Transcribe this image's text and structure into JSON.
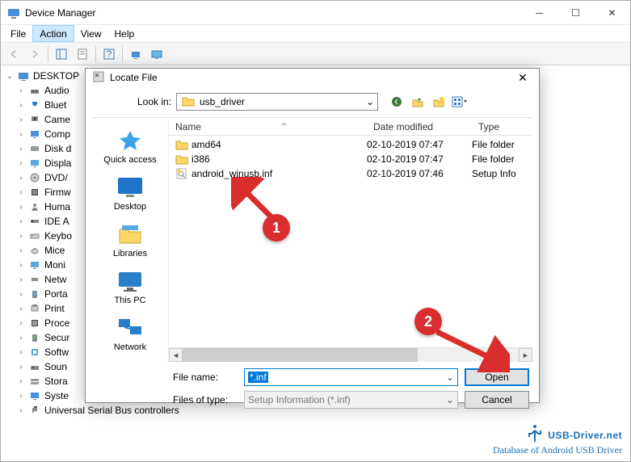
{
  "window": {
    "title": "Device Manager",
    "menu": [
      "File",
      "Action",
      "View",
      "Help"
    ],
    "active_menu_index": 1
  },
  "tree": {
    "root": "DESKTOP",
    "nodes": [
      "Audio",
      "Bluet",
      "Came",
      "Comp",
      "Disk d",
      "Displa",
      "DVD/",
      "Firmw",
      "Huma",
      "IDE A",
      "Keybo",
      "Mice",
      "Moni",
      "Netw",
      "Porta",
      "Print",
      "Proce",
      "Secur",
      "Softw",
      "Soun",
      "Stora",
      "Syste",
      "Universal Serial Bus controllers"
    ]
  },
  "dialog": {
    "title": "Locate File",
    "lookin_label": "Look in:",
    "lookin_value": "usb_driver",
    "places": [
      "Quick access",
      "Desktop",
      "Libraries",
      "This PC",
      "Network"
    ],
    "columns": {
      "name": "Name",
      "date": "Date modified",
      "type": "Type"
    },
    "files": [
      {
        "name": "amd64",
        "date": "02-10-2019 07:47",
        "type": "File folder",
        "kind": "folder"
      },
      {
        "name": "i386",
        "date": "02-10-2019 07:47",
        "type": "File folder",
        "kind": "folder"
      },
      {
        "name": "android_winusb.inf",
        "date": "02-10-2019 07:46",
        "type": "Setup Info",
        "kind": "inf"
      }
    ],
    "filename_label": "File name:",
    "filename_value": "*.inf",
    "filetype_label": "Files of type:",
    "filetype_value": "Setup Information (*.inf)",
    "open_btn": "Open",
    "cancel_btn": "Cancel"
  },
  "annotations": {
    "one": "1",
    "two": "2"
  },
  "watermark": {
    "main": "USB-Driver.net",
    "sub": "Database of Android USB Driver"
  }
}
